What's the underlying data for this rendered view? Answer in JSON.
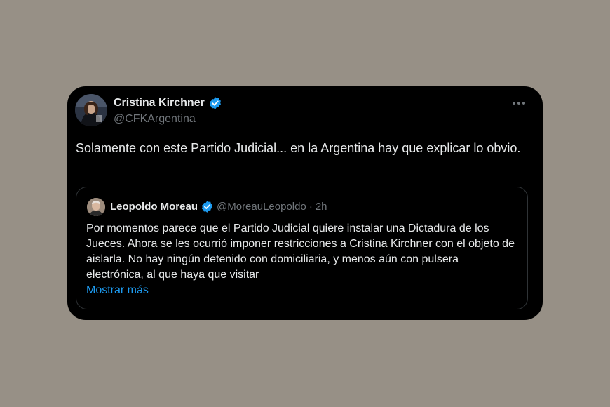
{
  "tweet": {
    "author": {
      "name": "Cristina Kirchner",
      "handle": "@CFKArgentina",
      "avatar_icon": "profile-photo"
    },
    "verified_color": "#1d9bf0",
    "text": "Solamente con este Partido Judicial... en la Argentina hay que explicar lo obvio.",
    "more_icon": "three-dots"
  },
  "quote": {
    "author": {
      "name": "Leopoldo Moreau",
      "handle": "@MoreauLeopoldo",
      "separator": "·",
      "time": "2h",
      "avatar_icon": "profile-photo"
    },
    "text": "Por momentos parece que el Partido Judicial quiere instalar una Dictadura de los Jueces. Ahora se les ocurrió imponer restricciones a Cristina Kirchner con el objeto de aislarla. No hay ningún detenido con domiciliaria, y menos aún con pulsera electrónica, al que haya que visitar",
    "show_more": "Mostrar más"
  },
  "colors": {
    "background": "#979086",
    "card": "#000000",
    "text": "#e7e9ea",
    "muted": "#71767b",
    "link": "#1d9bf0",
    "border": "#2f3336"
  }
}
